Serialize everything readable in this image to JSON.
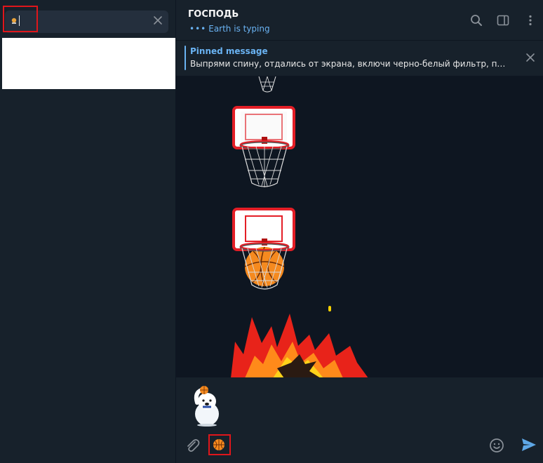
{
  "search": {
    "query_emoji_icon": "basketball-hoop-emoji",
    "clear_icon": "close-icon"
  },
  "chat": {
    "title": "ГОСПОДЬ",
    "typing_dots": "•••",
    "typing_status": "Earth is typing"
  },
  "header_icons": [
    "search-icon",
    "sidebar-toggle-icon",
    "more-vertical-icon"
  ],
  "pinned": {
    "label": "Pinned message",
    "text": "Выпрями спину, отдались от экрана, включи черно-белый фильтр, по..."
  },
  "messages": {
    "stickers": [
      "basketball-hoop-miss",
      "basketball-hoop-empty",
      "basketball-hoop-score",
      "fire-burst"
    ]
  },
  "composer": {
    "suggested_sticker": "polar-bear-basketball-sticker",
    "attach_icon": "paperclip-icon",
    "emoji_selected": "basketball-emoji",
    "emoji_icon": "smiley-icon",
    "send_icon": "send-icon"
  },
  "colors": {
    "accent": "#6ab3f3",
    "highlight": "#e0161b",
    "panel": "#17212b",
    "chat_bg": "#0e1621"
  }
}
